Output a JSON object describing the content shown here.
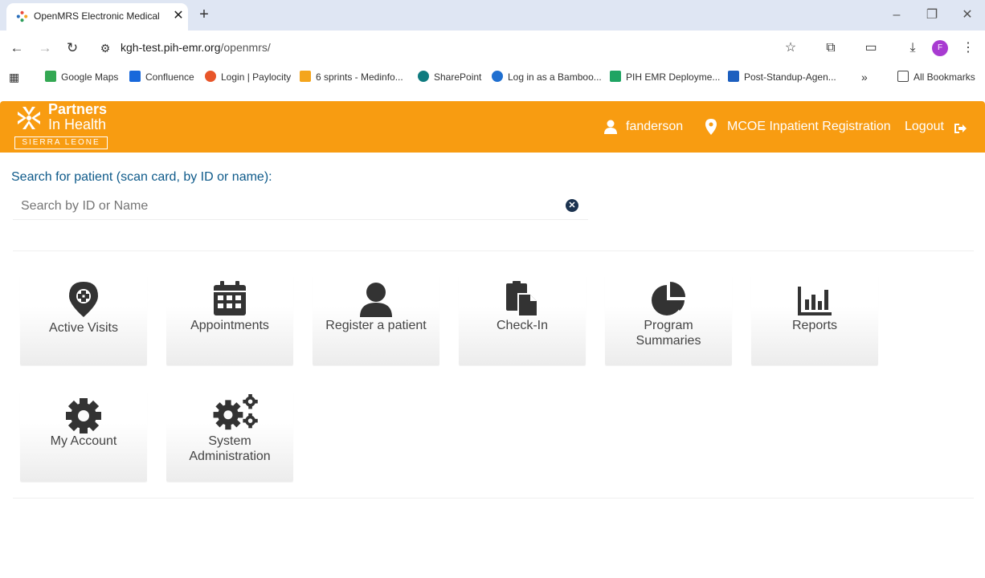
{
  "browser": {
    "tab_title": "OpenMRS Electronic Medical R",
    "tab_close": "✕",
    "new_tab": "+",
    "url_host": "kgh-test.pih-emr.org",
    "url_path": "/openmrs/",
    "profile_initial": "F",
    "bookmarks": [
      {
        "label": "Google Maps",
        "color": "#34a853"
      },
      {
        "label": "Confluence",
        "color": "#1868db"
      },
      {
        "label": "Login | Paylocity",
        "color": "#e8562a"
      },
      {
        "label": "6 sprints - Medinfo...",
        "color": "#f4a51c"
      },
      {
        "label": "SharePoint",
        "color": "#0f7b7f"
      },
      {
        "label": "Log in as a Bamboo...",
        "color": "#1f6fd0"
      },
      {
        "label": "PIH EMR Deployme...",
        "color": "#1fa463"
      },
      {
        "label": "Post-Standup-Agen...",
        "color": "#1d5fbf"
      }
    ],
    "more_bookmarks": "»",
    "all_bookmarks": "All Bookmarks"
  },
  "header": {
    "logo_line1": "Partners",
    "logo_line2": "In Health",
    "logo_country": "SIERRA LEONE",
    "username": "fanderson",
    "location": "MCOE Inpatient Registration",
    "logout": "Logout",
    "accent_color": "#f89c11"
  },
  "search": {
    "label": "Search for patient (scan card, by ID or name):",
    "placeholder": "Search by ID or Name",
    "value": "",
    "clear": "✕"
  },
  "tiles": [
    {
      "label": "Active Visits",
      "icon": "map-marker-icon"
    },
    {
      "label": "Appointments",
      "icon": "calendar-icon"
    },
    {
      "label": "Register a patient",
      "icon": "user-icon"
    },
    {
      "label": "Check-In",
      "icon": "clipboard-copy-icon"
    },
    {
      "label_line1": "Program",
      "label_line2": "Summaries",
      "icon": "pie-chart-icon"
    },
    {
      "label": "Reports",
      "icon": "bar-chart-icon"
    },
    {
      "label": "My Account",
      "icon": "gear-icon"
    },
    {
      "label_line1": "System",
      "label_line2": "Administration",
      "icon": "gears-icon"
    }
  ]
}
